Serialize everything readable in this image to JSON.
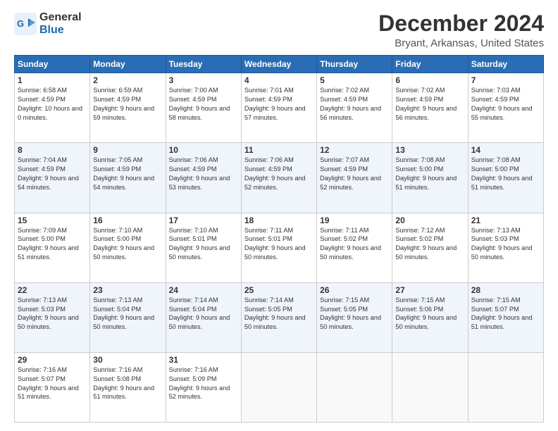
{
  "logo": {
    "line1": "General",
    "line2": "Blue"
  },
  "title": "December 2024",
  "subtitle": "Bryant, Arkansas, United States",
  "days_header": [
    "Sunday",
    "Monday",
    "Tuesday",
    "Wednesday",
    "Thursday",
    "Friday",
    "Saturday"
  ],
  "weeks": [
    [
      {
        "day": "1",
        "sunrise": "6:58 AM",
        "sunset": "4:59 PM",
        "daylight": "10 hours and 0 minutes."
      },
      {
        "day": "2",
        "sunrise": "6:59 AM",
        "sunset": "4:59 PM",
        "daylight": "9 hours and 59 minutes."
      },
      {
        "day": "3",
        "sunrise": "7:00 AM",
        "sunset": "4:59 PM",
        "daylight": "9 hours and 58 minutes."
      },
      {
        "day": "4",
        "sunrise": "7:01 AM",
        "sunset": "4:59 PM",
        "daylight": "9 hours and 57 minutes."
      },
      {
        "day": "5",
        "sunrise": "7:02 AM",
        "sunset": "4:59 PM",
        "daylight": "9 hours and 56 minutes."
      },
      {
        "day": "6",
        "sunrise": "7:02 AM",
        "sunset": "4:59 PM",
        "daylight": "9 hours and 56 minutes."
      },
      {
        "day": "7",
        "sunrise": "7:03 AM",
        "sunset": "4:59 PM",
        "daylight": "9 hours and 55 minutes."
      }
    ],
    [
      {
        "day": "8",
        "sunrise": "7:04 AM",
        "sunset": "4:59 PM",
        "daylight": "9 hours and 54 minutes."
      },
      {
        "day": "9",
        "sunrise": "7:05 AM",
        "sunset": "4:59 PM",
        "daylight": "9 hours and 54 minutes."
      },
      {
        "day": "10",
        "sunrise": "7:06 AM",
        "sunset": "4:59 PM",
        "daylight": "9 hours and 53 minutes."
      },
      {
        "day": "11",
        "sunrise": "7:06 AM",
        "sunset": "4:59 PM",
        "daylight": "9 hours and 52 minutes."
      },
      {
        "day": "12",
        "sunrise": "7:07 AM",
        "sunset": "4:59 PM",
        "daylight": "9 hours and 52 minutes."
      },
      {
        "day": "13",
        "sunrise": "7:08 AM",
        "sunset": "5:00 PM",
        "daylight": "9 hours and 51 minutes."
      },
      {
        "day": "14",
        "sunrise": "7:08 AM",
        "sunset": "5:00 PM",
        "daylight": "9 hours and 51 minutes."
      }
    ],
    [
      {
        "day": "15",
        "sunrise": "7:09 AM",
        "sunset": "5:00 PM",
        "daylight": "9 hours and 51 minutes."
      },
      {
        "day": "16",
        "sunrise": "7:10 AM",
        "sunset": "5:00 PM",
        "daylight": "9 hours and 50 minutes."
      },
      {
        "day": "17",
        "sunrise": "7:10 AM",
        "sunset": "5:01 PM",
        "daylight": "9 hours and 50 minutes."
      },
      {
        "day": "18",
        "sunrise": "7:11 AM",
        "sunset": "5:01 PM",
        "daylight": "9 hours and 50 minutes."
      },
      {
        "day": "19",
        "sunrise": "7:11 AM",
        "sunset": "5:02 PM",
        "daylight": "9 hours and 50 minutes."
      },
      {
        "day": "20",
        "sunrise": "7:12 AM",
        "sunset": "5:02 PM",
        "daylight": "9 hours and 50 minutes."
      },
      {
        "day": "21",
        "sunrise": "7:13 AM",
        "sunset": "5:03 PM",
        "daylight": "9 hours and 50 minutes."
      }
    ],
    [
      {
        "day": "22",
        "sunrise": "7:13 AM",
        "sunset": "5:03 PM",
        "daylight": "9 hours and 50 minutes."
      },
      {
        "day": "23",
        "sunrise": "7:13 AM",
        "sunset": "5:04 PM",
        "daylight": "9 hours and 50 minutes."
      },
      {
        "day": "24",
        "sunrise": "7:14 AM",
        "sunset": "5:04 PM",
        "daylight": "9 hours and 50 minutes."
      },
      {
        "day": "25",
        "sunrise": "7:14 AM",
        "sunset": "5:05 PM",
        "daylight": "9 hours and 50 minutes."
      },
      {
        "day": "26",
        "sunrise": "7:15 AM",
        "sunset": "5:05 PM",
        "daylight": "9 hours and 50 minutes."
      },
      {
        "day": "27",
        "sunrise": "7:15 AM",
        "sunset": "5:06 PM",
        "daylight": "9 hours and 50 minutes."
      },
      {
        "day": "28",
        "sunrise": "7:15 AM",
        "sunset": "5:07 PM",
        "daylight": "9 hours and 51 minutes."
      }
    ],
    [
      {
        "day": "29",
        "sunrise": "7:16 AM",
        "sunset": "5:07 PM",
        "daylight": "9 hours and 51 minutes."
      },
      {
        "day": "30",
        "sunrise": "7:16 AM",
        "sunset": "5:08 PM",
        "daylight": "9 hours and 51 minutes."
      },
      {
        "day": "31",
        "sunrise": "7:16 AM",
        "sunset": "5:09 PM",
        "daylight": "9 hours and 52 minutes."
      },
      null,
      null,
      null,
      null
    ]
  ]
}
